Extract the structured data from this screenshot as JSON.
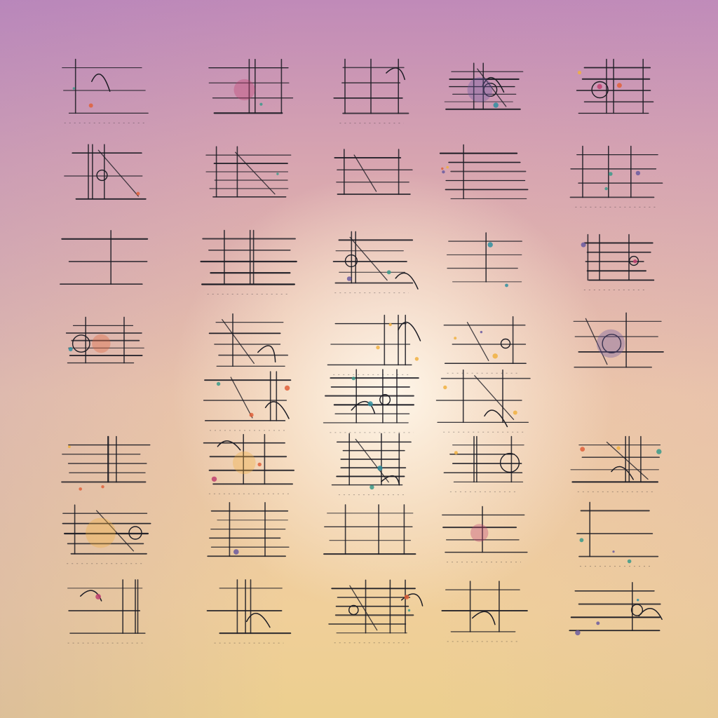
{
  "artwork": {
    "background_colors": [
      "#c08ab8",
      "#d7a4b0",
      "#eec8a8",
      "#f0cf9a",
      "#fff8ec"
    ],
    "ink_color": "#1c1c24",
    "accent_colors": [
      "#e0603a",
      "#f0b040",
      "#2f8fa0",
      "#c04070",
      "#6a5aa0",
      "#3a9a8a"
    ],
    "columns": 5,
    "rows": 8,
    "glyph_style": "abstract pseudo-characters built from horizontal rules, ticks, loops and small colored dots"
  }
}
